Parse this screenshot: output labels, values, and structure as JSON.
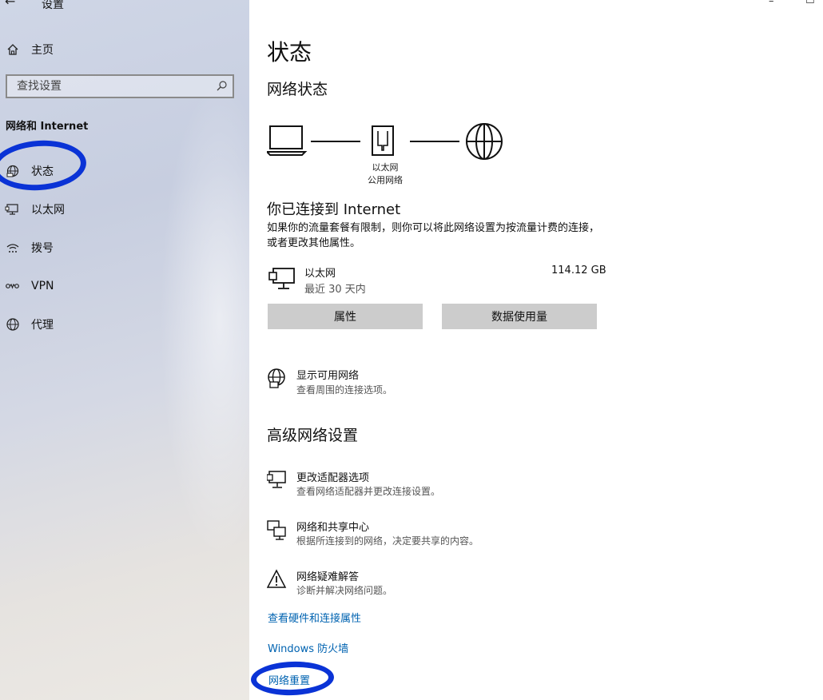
{
  "window": {
    "title": "设置",
    "back_glyph": "←",
    "minimize_glyph": "–",
    "maximize_glyph": "☐"
  },
  "sidebar": {
    "home_label": "主页",
    "search_placeholder": "查找设置",
    "section_header": "网络和 Internet",
    "items": [
      {
        "label": "状态",
        "icon": "globe-status-icon"
      },
      {
        "label": "以太网",
        "icon": "ethernet-icon"
      },
      {
        "label": "拨号",
        "icon": "dialup-icon"
      },
      {
        "label": "VPN",
        "icon": "vpn-icon"
      },
      {
        "label": "代理",
        "icon": "globe-icon"
      }
    ]
  },
  "main": {
    "title": "状态",
    "network_status_heading": "网络状态",
    "diagram_caption_1": "以太网",
    "diagram_caption_2": "公用网络",
    "connected_title": "你已连接到 Internet",
    "connected_desc": "如果你的流量套餐有限制，则你可以将此网络设置为按流量计费的连接，或者更改其他属性。",
    "adapter": {
      "name": "以太网",
      "period": "最近 30 天内",
      "usage": "114.12 GB"
    },
    "buttons": {
      "properties": "属性",
      "data_usage": "数据使用量"
    },
    "show_networks": {
      "title": "显示可用网络",
      "desc": "查看周围的连接选项。"
    },
    "advanced_heading": "高级网络设置",
    "advanced_items": [
      {
        "title": "更改适配器选项",
        "desc": "查看网络适配器并更改连接设置。",
        "icon": "adapter-monitor-icon"
      },
      {
        "title": "网络和共享中心",
        "desc": "根据所连接到的网络，决定要共享的内容。",
        "icon": "sharing-center-icon"
      },
      {
        "title": "网络疑难解答",
        "desc": "诊断并解决网络问题。",
        "icon": "warning-icon"
      }
    ],
    "links": {
      "hardware": "查看硬件和连接属性",
      "firewall": "Windows 防火墙",
      "reset": "网络重置"
    }
  },
  "colors": {
    "link": "#0063b1",
    "annotation": "#0a33d6",
    "button_bg": "#cccccc"
  }
}
